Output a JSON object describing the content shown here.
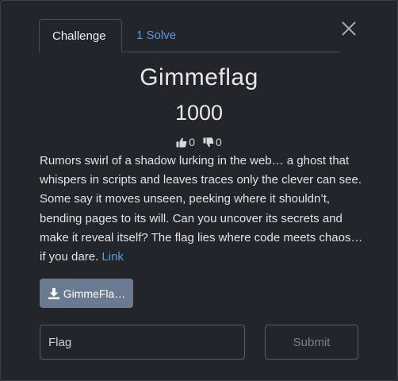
{
  "tabs": {
    "challenge_label": "Challenge",
    "solves_label": "1 Solve"
  },
  "challenge": {
    "name": "Gimmeflag",
    "value": "1000",
    "likes": "0",
    "dislikes": "0",
    "description": "Rumors swirl of a shadow lurking in the web… a ghost that whispers in scripts and leaves traces only the clever can see. Some say it moves unseen, peeking where it shouldn’t, bending pages to its will. Can you uncover its secrets and make it reveal itself? The flag lies where code meets chaos… if you dare.",
    "link_label": "Link",
    "file_label": "GimmeFla…"
  },
  "form": {
    "flag_placeholder": "Flag",
    "submit_label": "Submit"
  },
  "icons": {
    "close": "close-icon",
    "thumbs_up": "thumbs-up-icon",
    "thumbs_down": "thumbs-down-icon",
    "download": "download-icon"
  },
  "colors": {
    "background": "#22252a",
    "link": "#5b9bd5",
    "file_button": "#6a7a90"
  }
}
